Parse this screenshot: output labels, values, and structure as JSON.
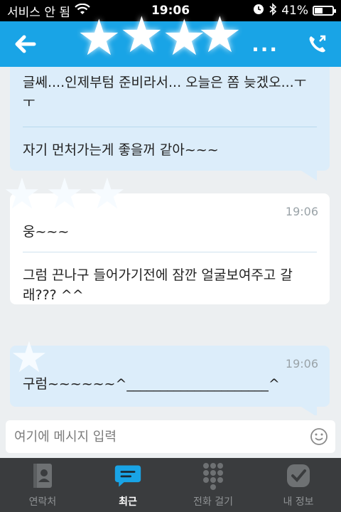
{
  "status_bar": {
    "carrier": "서비스 안 됨",
    "time": "19:06",
    "battery": "41%"
  },
  "header": {
    "more_label": "..."
  },
  "messages": [
    {
      "lines": [
        "글쎄....인제부텀 준비라서... 오늘은 쫌 늦겠오...ㅜ",
        "ㅜ"
      ],
      "second": "자기 먼처가는게 좋을꺼 같아~~~"
    },
    {
      "time": "19:06",
      "first": "웅~~~",
      "second_lines": [
        "그럼 끈나구 들어가기전에  잠깐 얼굴보여주고 갈",
        "래???  ^^"
      ]
    },
    {
      "time": "19:06",
      "text": "구럼~~~~~~^_____________________^"
    }
  ],
  "input": {
    "placeholder": "여기에 메시지 입력"
  },
  "nav": {
    "items": [
      {
        "label": "연락처",
        "icon": "contacts-icon"
      },
      {
        "label": "최근",
        "icon": "chat-icon"
      },
      {
        "label": "전화 걸기",
        "icon": "dialpad-icon"
      },
      {
        "label": "내 정보",
        "icon": "profile-icon"
      }
    ],
    "active_index": 1
  },
  "colors": {
    "header": "#19a4e6",
    "mine_bubble": "#dcedfa",
    "theirs_bubble": "#ffffff",
    "nav_bg": "#3a3c3e",
    "accent": "#19a4e6"
  }
}
